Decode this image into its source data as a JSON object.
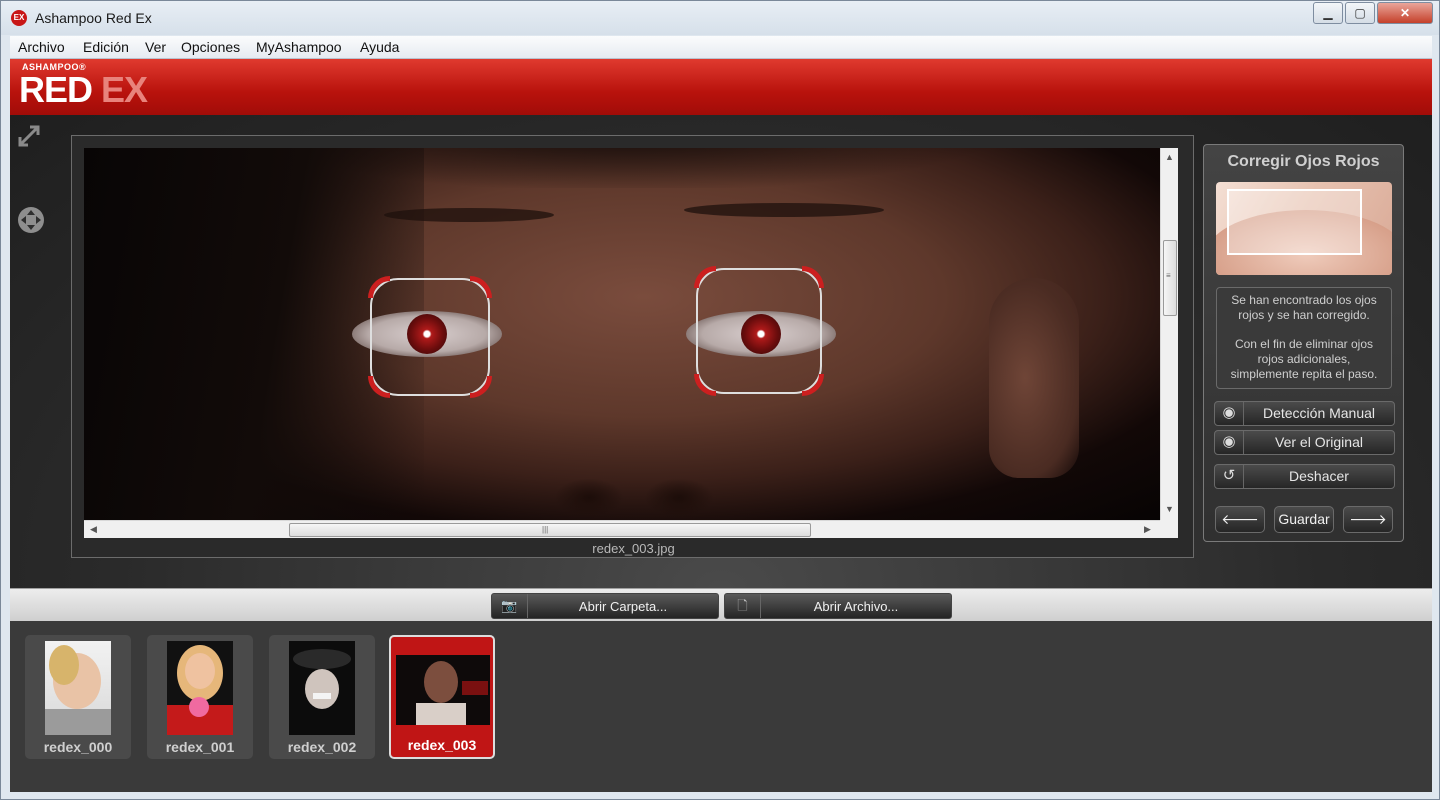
{
  "window": {
    "title": "Ashampoo Red Ex",
    "app_icon": "red-ex-app-icon"
  },
  "titlebar_buttons": {
    "minimize": "▁",
    "maximize": "▢",
    "close": "✕"
  },
  "menu": [
    "Archivo",
    "Edición",
    "Ver",
    "Opciones",
    "MyAshampoo",
    "Ayuda"
  ],
  "brand": {
    "small": "ASHAMPOO®",
    "red": "RED",
    "ex": "EX"
  },
  "viewer": {
    "filename": "redex_003.jpg"
  },
  "panel": {
    "title": "Corregir Ojos Rojos",
    "info_1": "Se han encontrado los ojos rojos y se han corregido.",
    "info_2": "Con el fin de eliminar ojos rojos adicionales, simplemente repita el paso.",
    "manual_label": "Detección Manual",
    "original_label": "Ver el Original",
    "undo_label": "Deshacer",
    "save_label": "Guardar"
  },
  "toolbar": {
    "open_folder_label": "Abrir Carpeta...",
    "open_file_label": "Abrir Archivo..."
  },
  "thumbnails": [
    {
      "name": "redex_000"
    },
    {
      "name": "redex_001"
    },
    {
      "name": "redex_002"
    },
    {
      "name": "redex_003",
      "selected": true
    }
  ],
  "colors": {
    "brand_red": "#c4140e",
    "selection_red": "#c01515",
    "marker_red": "#cc1f1f"
  }
}
